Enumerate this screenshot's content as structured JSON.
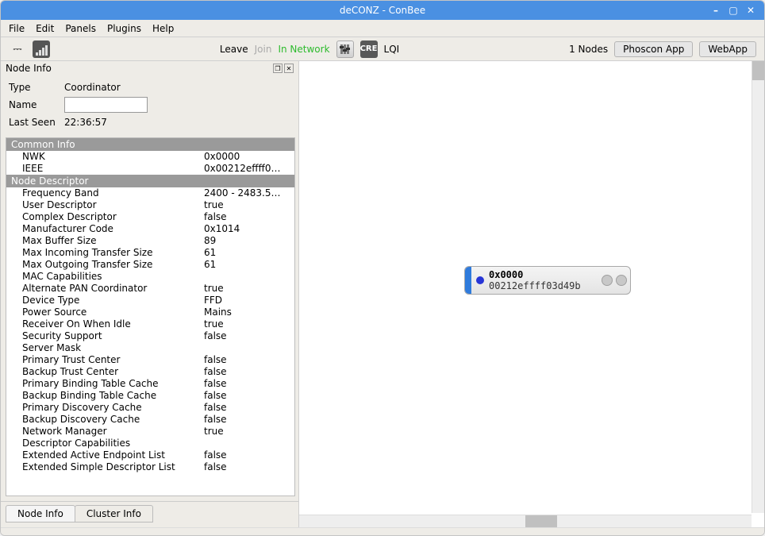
{
  "window": {
    "title": "deCONZ - ConBee"
  },
  "menu": {
    "file": "File",
    "edit": "Edit",
    "panels": "Panels",
    "plugins": "Plugins",
    "help": "Help"
  },
  "toolbar": {
    "leave": "Leave",
    "join": "Join",
    "network_status": "In Network",
    "lqi": "LQI",
    "nodes_count": "1 Nodes",
    "phoscon": "Phoscon App",
    "webapp": "WebApp",
    "cre": "CRE"
  },
  "panel": {
    "title": "Node Info",
    "type_label": "Type",
    "type_value": "Coordinator",
    "name_label": "Name",
    "name_value": "",
    "lastseen_label": "Last Seen",
    "lastseen_value": "22:36:57",
    "groups": {
      "common": "Common Info",
      "nodedesc": "Node Descriptor"
    },
    "props": [
      {
        "k": "NWK",
        "v": "0x0000"
      },
      {
        "k": "IEEE",
        "v": "0x00212effff0…"
      }
    ],
    "props2": [
      {
        "k": "Frequency Band",
        "v": "2400 - 2483.5…"
      },
      {
        "k": "User Descriptor",
        "v": "true"
      },
      {
        "k": "Complex Descriptor",
        "v": "false"
      },
      {
        "k": "Manufacturer Code",
        "v": "0x1014"
      },
      {
        "k": "Max Buffer Size",
        "v": "89"
      },
      {
        "k": "Max Incoming Transfer Size",
        "v": "61"
      },
      {
        "k": "Max Outgoing Transfer Size",
        "v": "61"
      },
      {
        "k": "MAC Capabilities",
        "v": ""
      },
      {
        "k": "Alternate PAN Coordinator",
        "v": "true"
      },
      {
        "k": "Device Type",
        "v": "FFD"
      },
      {
        "k": "Power Source",
        "v": "Mains"
      },
      {
        "k": "Receiver On When Idle",
        "v": "true"
      },
      {
        "k": "Security Support",
        "v": "false"
      },
      {
        "k": "Server Mask",
        "v": ""
      },
      {
        "k": "Primary Trust Center",
        "v": "false"
      },
      {
        "k": "Backup Trust Center",
        "v": "false"
      },
      {
        "k": "Primary Binding Table Cache",
        "v": "false"
      },
      {
        "k": "Backup Binding Table Cache",
        "v": "false"
      },
      {
        "k": "Primary Discovery Cache",
        "v": "false"
      },
      {
        "k": "Backup Discovery Cache",
        "v": "false"
      },
      {
        "k": "Network Manager",
        "v": "true"
      },
      {
        "k": "Descriptor Capabilities",
        "v": ""
      },
      {
        "k": "Extended Active Endpoint List",
        "v": "false"
      },
      {
        "k": "Extended Simple Descriptor List",
        "v": "false"
      }
    ]
  },
  "tabs": {
    "nodeinfo": "Node Info",
    "clusterinfo": "Cluster Info"
  },
  "canvas_node": {
    "addr": "0x0000",
    "ieee": "00212effff03d49b"
  }
}
